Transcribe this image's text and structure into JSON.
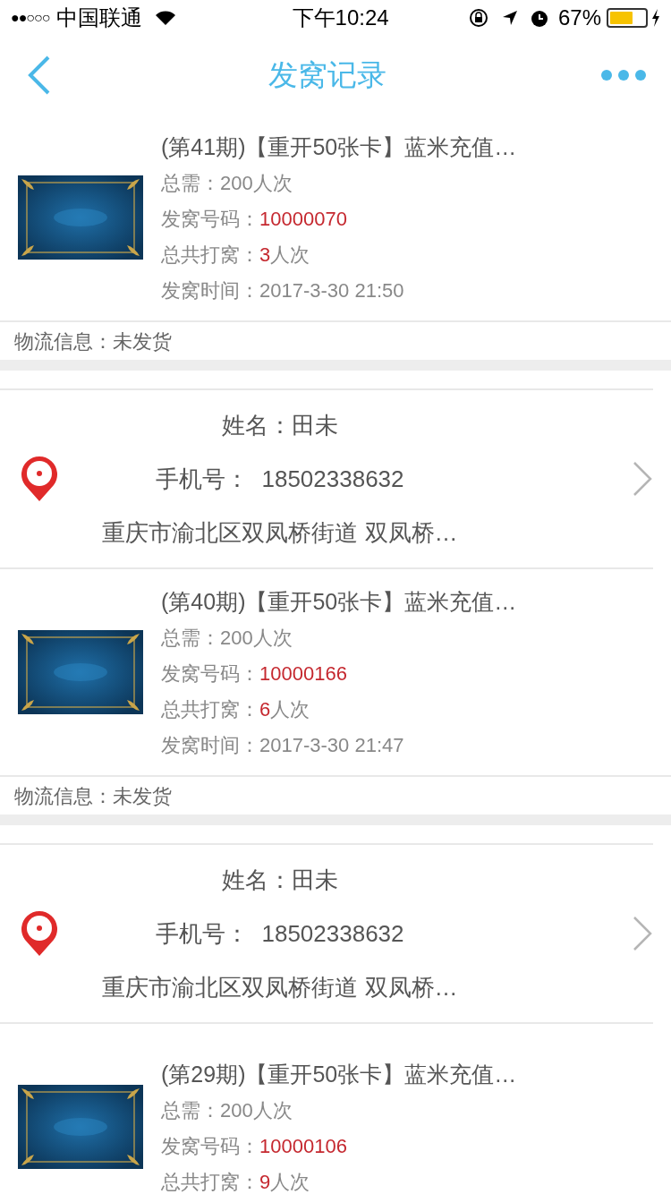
{
  "status_bar": {
    "signal": "●●○○○",
    "carrier": "中国联通",
    "time": "下午10:24",
    "battery_text": "67%",
    "battery": {
      "level": 0.67
    }
  },
  "nav": {
    "title": "发窝记录"
  },
  "sections": [
    {
      "kind": "product",
      "title": "(第41期)【重开50张卡】蓝米充值…",
      "fields": [
        {
          "label": "总需：",
          "value": "200人次",
          "kind": "plain"
        },
        {
          "label": "发窝号码：",
          "value": "10000070",
          "kind": "accent"
        },
        {
          "label": "总共打窝：",
          "value": "3",
          "unit": "人次",
          "kind": "accent"
        },
        {
          "label": "发窝时间：",
          "value": "2017-3-30 21:50",
          "kind": "plain"
        }
      ]
    },
    {
      "kind": "logistics",
      "label": "物流信息：",
      "value": "未发货"
    },
    {
      "kind": "address",
      "name_label": "姓名：",
      "name": "田未",
      "phone_label": "手机号：",
      "phone": "18502338632",
      "address": "重庆市渝北区双凤桥街道 双凤桥…"
    },
    {
      "kind": "product",
      "title": "(第40期)【重开50张卡】蓝米充值…",
      "fields": [
        {
          "label": "总需：",
          "value": "200人次",
          "kind": "plain"
        },
        {
          "label": "发窝号码：",
          "value": "10000166",
          "kind": "accent"
        },
        {
          "label": "总共打窝：",
          "value": "6",
          "unit": "人次",
          "kind": "accent"
        },
        {
          "label": "发窝时间：",
          "value": "2017-3-30 21:47",
          "kind": "plain"
        }
      ]
    },
    {
      "kind": "logistics",
      "label": "物流信息：",
      "value": "未发货"
    },
    {
      "kind": "address",
      "name_label": "姓名：",
      "name": "田未",
      "phone_label": "手机号：",
      "phone": "18502338632",
      "address": "重庆市渝北区双凤桥街道 双凤桥…"
    },
    {
      "kind": "product",
      "title": "(第29期)【重开50张卡】蓝米充值…",
      "fields": [
        {
          "label": "总需：",
          "value": "200人次",
          "kind": "plain"
        },
        {
          "label": "发窝号码：",
          "value": "10000106",
          "kind": "accent"
        },
        {
          "label": "总共打窝：",
          "value": "9",
          "unit": "人次",
          "kind": "accent"
        }
      ]
    }
  ]
}
